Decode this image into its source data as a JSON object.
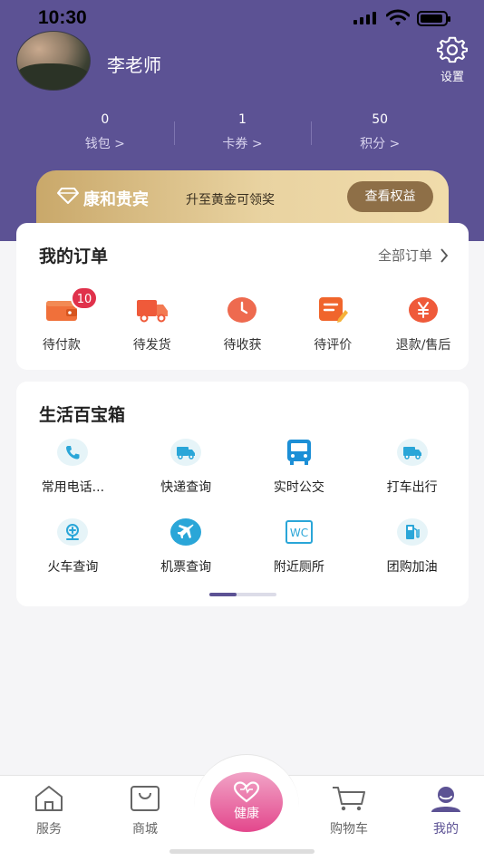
{
  "status_bar": {
    "time": "10:30"
  },
  "profile": {
    "name": "李老师",
    "settings_label": "设置"
  },
  "stats": [
    {
      "value": "0",
      "label": "钱包 >"
    },
    {
      "value": "1",
      "label": "卡券 >"
    },
    {
      "value": "50",
      "label": "积分 >"
    }
  ],
  "vip": {
    "title": "康和贵宾",
    "subtitle": "升至黄金可领奖",
    "button": "查看权益"
  },
  "orders": {
    "title": "我的订单",
    "all_label": "全部订单",
    "items": [
      {
        "label": "待付款",
        "icon": "wallet-icon",
        "badge": "10"
      },
      {
        "label": "待发货",
        "icon": "truck-icon"
      },
      {
        "label": "待收获",
        "icon": "clock-icon"
      },
      {
        "label": "待评价",
        "icon": "edit-icon"
      },
      {
        "label": "退款/售后",
        "icon": "yen-icon"
      }
    ]
  },
  "toolbox": {
    "title": "生活百宝箱",
    "items": [
      {
        "label": "常用电话...",
        "icon": "phone-icon"
      },
      {
        "label": "快递查询",
        "icon": "express-truck-icon"
      },
      {
        "label": "实时公交",
        "icon": "bus-icon"
      },
      {
        "label": "打车出行",
        "icon": "taxi-icon"
      },
      {
        "label": "火车查询",
        "icon": "train-icon"
      },
      {
        "label": "机票查询",
        "icon": "plane-icon"
      },
      {
        "label": "附近厕所",
        "icon": "wc-icon"
      },
      {
        "label": "团购加油",
        "icon": "fuel-icon"
      }
    ]
  },
  "tabbar": {
    "tabs": [
      {
        "label": "服务",
        "icon": "home-icon"
      },
      {
        "label": "商城",
        "icon": "shopping-bag-icon"
      },
      {
        "label": "健康",
        "icon": "heart-icon"
      },
      {
        "label": "购物车",
        "icon": "cart-icon"
      },
      {
        "label": "我的",
        "icon": "profile-icon"
      }
    ],
    "active": "我的"
  },
  "colors": {
    "primary": "#5c5294",
    "badge": "#e0314b",
    "gold": "#e9d3a1",
    "health": "#e3478c"
  }
}
